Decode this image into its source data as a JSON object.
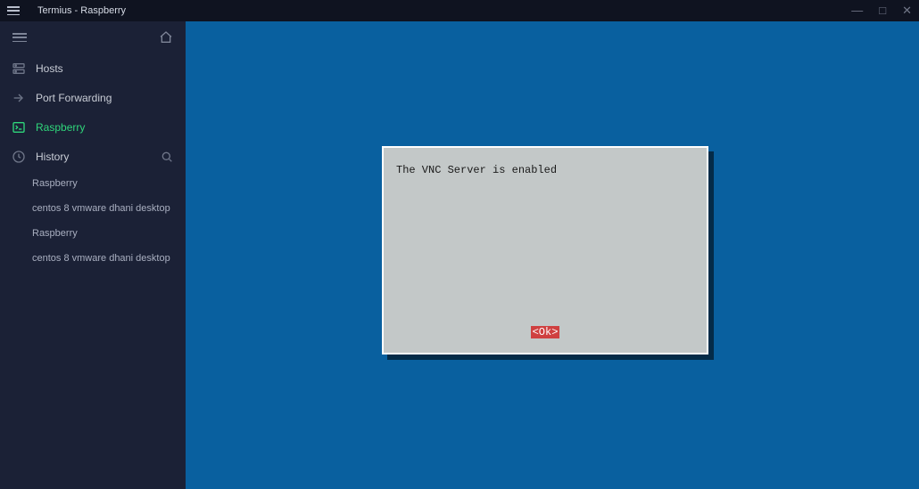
{
  "window": {
    "title": "Termius - Raspberry"
  },
  "sidebar": {
    "items": [
      {
        "label": "Hosts"
      },
      {
        "label": "Port Forwarding"
      },
      {
        "label": "Raspberry"
      },
      {
        "label": "History"
      }
    ],
    "history": [
      {
        "label": "Raspberry"
      },
      {
        "label": "centos 8 vmware dhani desktop"
      },
      {
        "label": "Raspberry"
      },
      {
        "label": "centos 8 vmware dhani desktop"
      }
    ]
  },
  "terminal": {
    "dialog": {
      "message": "The VNC Server is enabled",
      "ok_label": "<Ok>"
    }
  }
}
